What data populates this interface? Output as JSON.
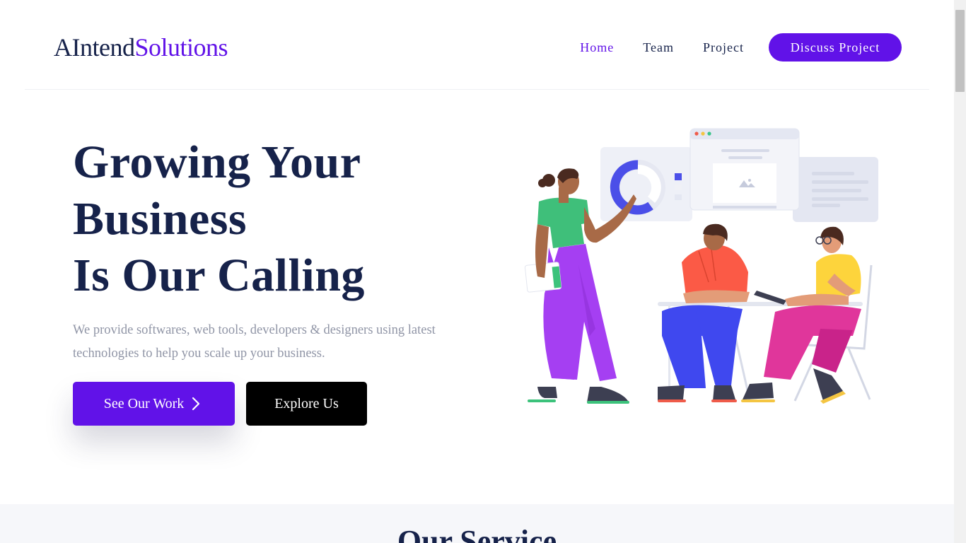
{
  "brand": {
    "part1": "AIntend",
    "part2": "Solutions"
  },
  "nav": {
    "links": [
      {
        "label": "Home",
        "active": true
      },
      {
        "label": "Team",
        "active": false
      },
      {
        "label": "Project",
        "active": false
      }
    ],
    "cta_label": "Discuss Project"
  },
  "hero": {
    "title_lines": [
      "Growing Your",
      "Business",
      "Is Our Calling"
    ],
    "description": "We provide softwares, web tools, developers & designers using latest technologies to help you scale up your business.",
    "primary_button": "See Our Work",
    "secondary_button": "Explore Us",
    "illustration_icon": "team-presentation-illustration"
  },
  "service": {
    "title": "Our Service"
  },
  "colors": {
    "accent": "#6112e8",
    "heading": "#16224a",
    "muted": "#9095a6",
    "dark_button": "#000000",
    "section_bg": "#f6f7fa"
  }
}
